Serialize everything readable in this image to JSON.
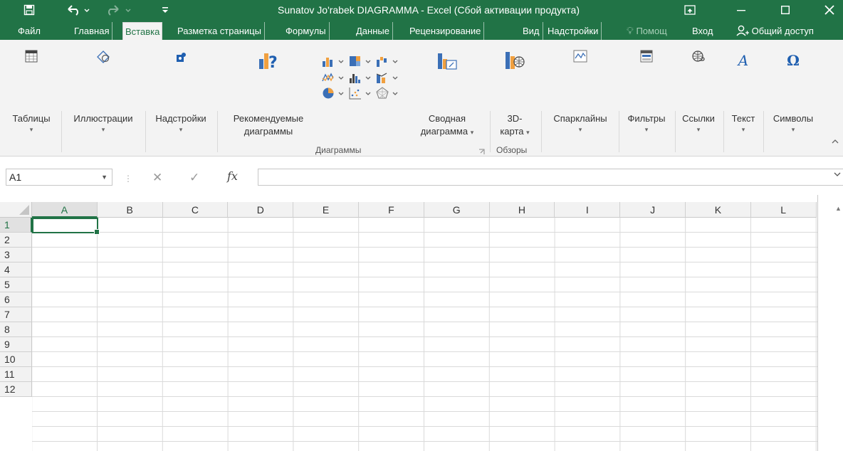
{
  "titlebar": {
    "save_icon": "save-icon",
    "undo_icon": "undo-icon",
    "redo_icon": "redo-icon",
    "customize_icon": "customize-qat-icon",
    "title": "Sunatov Jo'rabek DIAGRAMMA - Excel (Сбой активации продукта)",
    "ribbon_options_icon": "ribbon-display-options-icon",
    "minimize_icon": "minimize-icon",
    "maximize_icon": "maximize-icon",
    "close_icon": "close-icon"
  },
  "tabs": {
    "file": "Файл",
    "home": "Главная",
    "insert": "Вставка",
    "page_layout": "Разметка страницы",
    "formulas": "Формулы",
    "data": "Данные",
    "review": "Рецензирование",
    "view": "Вид",
    "addins": "Надстройки",
    "tell_me": "Помощ",
    "sign_in": "Вход",
    "share": "Общий доступ"
  },
  "ribbon": {
    "tables": "Таблицы",
    "illustrations": "Иллюстрации",
    "addins": "Надстройки",
    "recommended_line1": "Рекомендуемые",
    "recommended_line2": "диаграммы",
    "pivot_line1": "Сводная",
    "pivot_line2": "диаграмма",
    "map_line1": "3D-",
    "map_line2": "карта",
    "sparklines": "Спарклайны",
    "filters": "Фильтры",
    "links": "Ссылки",
    "text": "Текст",
    "symbols": "Символы",
    "group_charts": "Диаграммы",
    "group_tours": "Обзоры"
  },
  "formula_bar": {
    "name_box": "A1",
    "fx_label": "fx",
    "cancel_symbol": "✕",
    "enter_symbol": "✓",
    "value": ""
  },
  "sheet": {
    "columns": [
      "A",
      "B",
      "C",
      "D",
      "E",
      "F",
      "G",
      "H",
      "I",
      "J",
      "K",
      "L"
    ],
    "rows": [
      "1",
      "2",
      "3",
      "4",
      "5",
      "6",
      "7",
      "8",
      "9",
      "10",
      "11",
      "12"
    ],
    "active_cell": "A1"
  },
  "colors": {
    "excel_green": "#217346",
    "ribbon_bg": "#f3f3f3",
    "grid_line": "#dadada"
  }
}
